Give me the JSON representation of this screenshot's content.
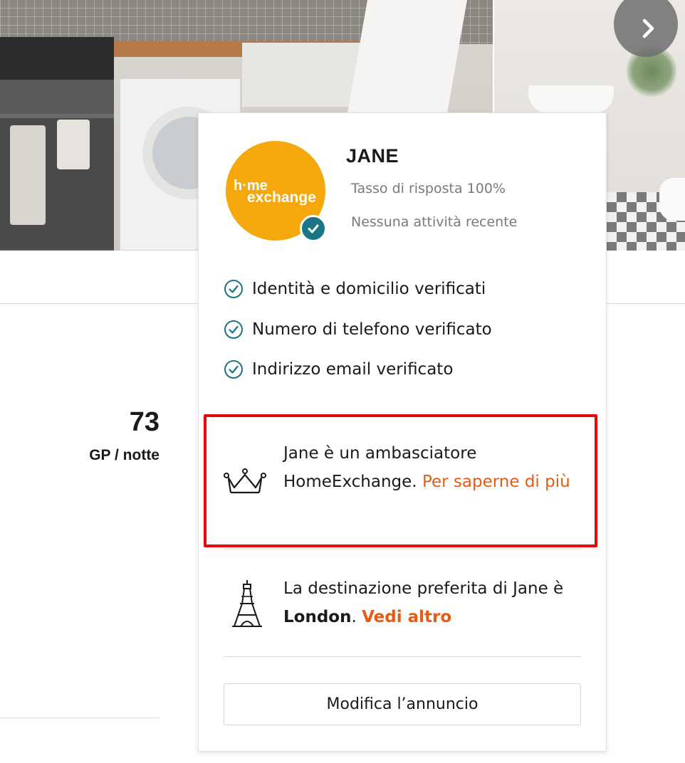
{
  "gallery": {
    "next_icon": "chevron-right-icon"
  },
  "listing": {
    "price": "73",
    "price_unit": "GP / notte"
  },
  "host": {
    "logo_text": "home exchange",
    "name": "JANE",
    "response_rate": "Tasso di risposta 100%",
    "activity": "Nessuna attività recente",
    "verifications": [
      {
        "label": "Identità e domicilio verificati",
        "icon": "check-circle-icon"
      },
      {
        "label": "Numero di telefono verificato",
        "icon": "check-circle-icon"
      },
      {
        "label": "Indirizzo email verificato",
        "icon": "check-circle-icon"
      }
    ]
  },
  "ambassador": {
    "icon": "crown-icon",
    "text": "Jane è un ambasciatore HomeExchange.",
    "link": "Per saperne di più"
  },
  "destination": {
    "icon": "eiffel-tower-icon",
    "text_before": "La destinazione preferita di Jane è",
    "city": "London",
    "after": ".",
    "link": "Vedi altro"
  },
  "actions": {
    "edit_label": "Modifica l’annuncio"
  },
  "colors": {
    "accent": "#e85b12",
    "brand": "#f5a80c",
    "teal": "#1b7584",
    "highlight": "#e5070a"
  }
}
